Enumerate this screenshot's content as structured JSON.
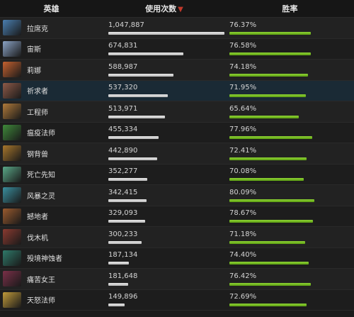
{
  "header": {
    "hero": "英雄",
    "uses": "使用次数",
    "sort_icon": "chevron-down-icon",
    "winrate": "胜率"
  },
  "max_uses": 1047887,
  "rows": [
    {
      "name": "拉席克",
      "uses": "1,047,887",
      "uses_num": 1047887,
      "winrate": "76.37%",
      "win_num": 76.37,
      "color": "#4a7fb0"
    },
    {
      "name": "宙斯",
      "uses": "674,831",
      "uses_num": 674831,
      "winrate": "76.58%",
      "win_num": 76.58,
      "color": "#8aa2c4"
    },
    {
      "name": "莉娜",
      "uses": "588,987",
      "uses_num": 588987,
      "winrate": "74.18%",
      "win_num": 74.18,
      "color": "#c4612f"
    },
    {
      "name": "祈求者",
      "uses": "537,320",
      "uses_num": 537320,
      "winrate": "71.95%",
      "win_num": 71.95,
      "color": "#8e5a48"
    },
    {
      "name": "工程师",
      "uses": "513,971",
      "uses_num": 513971,
      "winrate": "65.64%",
      "win_num": 65.64,
      "color": "#b07a3a"
    },
    {
      "name": "瘟疫法师",
      "uses": "455,334",
      "uses_num": 455334,
      "winrate": "77.96%",
      "win_num": 77.96,
      "color": "#3f8a3a"
    },
    {
      "name": "钢背兽",
      "uses": "442,890",
      "uses_num": 442890,
      "winrate": "72.41%",
      "win_num": 72.41,
      "color": "#a7762c"
    },
    {
      "name": "死亡先知",
      "uses": "352,277",
      "uses_num": 352277,
      "winrate": "70.08%",
      "win_num": 70.08,
      "color": "#5aa888"
    },
    {
      "name": "风暴之灵",
      "uses": "342,415",
      "uses_num": 342415,
      "winrate": "80.09%",
      "win_num": 80.09,
      "color": "#3a8f9e"
    },
    {
      "name": "撼地者",
      "uses": "329,093",
      "uses_num": 329093,
      "winrate": "78.67%",
      "win_num": 78.67,
      "color": "#9a5a2e"
    },
    {
      "name": "伐木机",
      "uses": "300,233",
      "uses_num": 300233,
      "winrate": "71.18%",
      "win_num": 71.18,
      "color": "#8a3a30"
    },
    {
      "name": "殁境神蚀者",
      "uses": "187,134",
      "uses_num": 187134,
      "winrate": "74.40%",
      "win_num": 74.4,
      "color": "#2f7a6a"
    },
    {
      "name": "痛苦女王",
      "uses": "181,648",
      "uses_num": 181648,
      "winrate": "76.42%",
      "win_num": 76.42,
      "color": "#7a3048"
    },
    {
      "name": "天怒法师",
      "uses": "149,896",
      "uses_num": 149896,
      "winrate": "72.69%",
      "win_num": 72.69,
      "color": "#c09a3a"
    }
  ]
}
